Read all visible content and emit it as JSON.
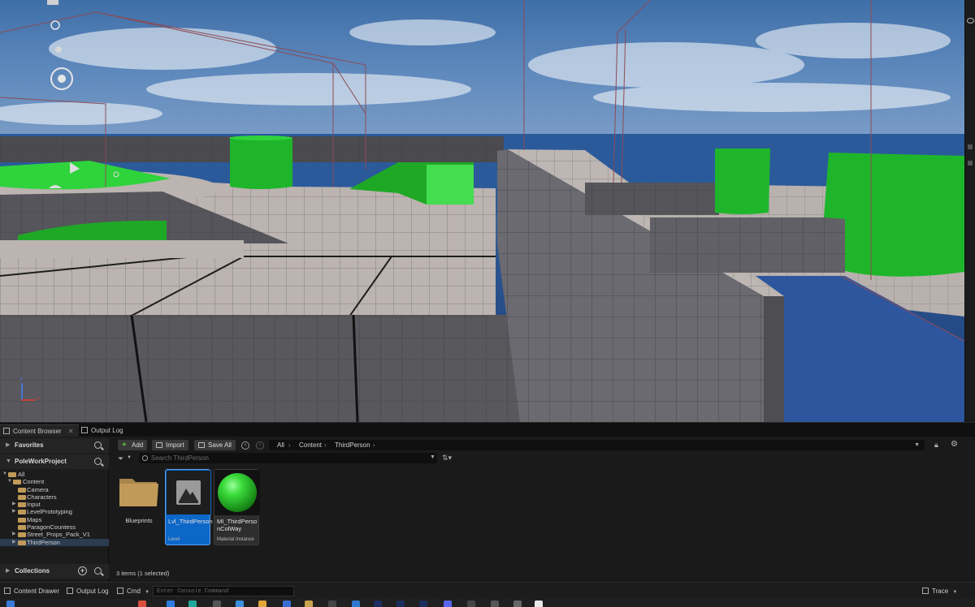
{
  "panel_tabs": {
    "content_browser": "Content Browser",
    "close": "✕",
    "output_log": "Output Log"
  },
  "sidebar": {
    "favorites": "Favorites",
    "project": "PoleWorkProject",
    "collections": "Collections",
    "tree": [
      {
        "label": "All",
        "level": 0,
        "expanded": true
      },
      {
        "label": "Content",
        "level": 1,
        "expanded": true
      },
      {
        "label": "Camera",
        "level": 2
      },
      {
        "label": "Characters",
        "level": 2
      },
      {
        "label": "Input",
        "level": 2,
        "has_children": true
      },
      {
        "label": "LevelPrototyping",
        "level": 2,
        "has_children": true
      },
      {
        "label": "Maps",
        "level": 2
      },
      {
        "label": "ParagonCountess",
        "level": 2
      },
      {
        "label": "Street_Props_Pack_V1",
        "level": 2,
        "has_children": true
      },
      {
        "label": "ThirdPerson",
        "level": 2,
        "has_children": true,
        "selected": true
      }
    ]
  },
  "toolbar": {
    "add": "Add",
    "import": "Import",
    "save_all": "Save All"
  },
  "breadcrumb": [
    "All",
    "Content",
    "ThirdPerson"
  ],
  "search": {
    "placeholder": "Search ThirdPerson",
    "value": ""
  },
  "assets": [
    {
      "name": "Blueprints",
      "type": "",
      "kind": "folder"
    },
    {
      "name": "Lvl_ThirdPerson",
      "type": "Level",
      "kind": "level",
      "selected": true
    },
    {
      "name": "MI_ThirdPersonColWay",
      "type": "Material Instance",
      "kind": "material"
    }
  ],
  "status_text": "3 items (1 selected)",
  "status_bar": {
    "content_drawer": "Content Drawer",
    "output_log": "Output Log",
    "cmd": "Cmd",
    "console_placeholder": "Enter Console Command",
    "trace": "Trace"
  },
  "gizmo": {
    "z": "z",
    "x": "x"
  },
  "colors": {
    "selection": "#0d67c9",
    "accent_green": "#5fbf3a",
    "folder": "#c19a5a",
    "green_geometry": "#1fb52b"
  }
}
